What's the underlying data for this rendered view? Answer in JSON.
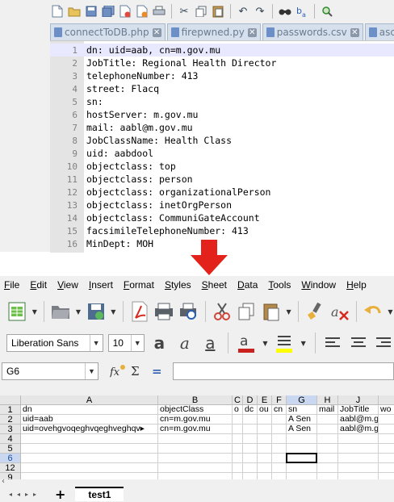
{
  "editor": {
    "toolbar_icons": [
      "new-file-icon",
      "open-file-icon",
      "save-icon",
      "save-all-icon",
      "close-icon",
      "close-all-icon",
      "print-icon",
      "cut-icon",
      "copy-icon",
      "paste-icon",
      "undo-icon",
      "redo-icon",
      "find-icon",
      "replace-icon",
      "zoom-icon"
    ],
    "tabs": [
      {
        "label": "connectToDB.php"
      },
      {
        "label": "firepwned.py"
      },
      {
        "label": "passwords.csv"
      },
      {
        "label": "ascii"
      }
    ],
    "lines": [
      {
        "num": "1",
        "text": "dn: uid=aab, cn=m.gov.mu"
      },
      {
        "num": "2",
        "text": "JobTitle: Regional Health Director"
      },
      {
        "num": "3",
        "text": "telephoneNumber: 413"
      },
      {
        "num": "4",
        "text": "street: Flacq"
      },
      {
        "num": "5",
        "text": "sn:"
      },
      {
        "num": "6",
        "text": "hostServer: m.gov.mu"
      },
      {
        "num": "7",
        "text": "mail: aabl@m.gov.mu"
      },
      {
        "num": "8",
        "text": "JobClassName: Health Class"
      },
      {
        "num": "9",
        "text": "uid: aabdool"
      },
      {
        "num": "10",
        "text": "objectclass: top"
      },
      {
        "num": "11",
        "text": "objectclass: person"
      },
      {
        "num": "12",
        "text": "objectclass: organizationalPerson"
      },
      {
        "num": "13",
        "text": "objectclass: inetOrgPerson"
      },
      {
        "num": "14",
        "text": "objectclass: CommuniGateAccount"
      },
      {
        "num": "15",
        "text": "facsimileTelephoneNumber: 413"
      },
      {
        "num": "16",
        "text": "MinDept: MOH"
      }
    ]
  },
  "calc": {
    "menu": [
      "File",
      "Edit",
      "View",
      "Insert",
      "Format",
      "Styles",
      "Sheet",
      "Data",
      "Tools",
      "Window",
      "Help"
    ],
    "font_name": "Liberation Sans",
    "font_size": "10",
    "name_box": "G6",
    "columns": [
      {
        "label": "A",
        "selected": false
      },
      {
        "label": "B",
        "selected": false
      },
      {
        "label": "C",
        "selected": false
      },
      {
        "label": "D",
        "selected": false
      },
      {
        "label": "E",
        "selected": false
      },
      {
        "label": "F",
        "selected": false
      },
      {
        "label": "G",
        "selected": true
      },
      {
        "label": "H",
        "selected": false
      },
      {
        "label": "J",
        "selected": false
      }
    ],
    "rows": [
      {
        "label": "1",
        "selected": false,
        "cells": [
          "dn",
          "objectClass",
          "o",
          "dc",
          "ou",
          "cn",
          "sn",
          "mail",
          "JobTitle",
          "wo"
        ]
      },
      {
        "label": "2",
        "selected": false,
        "cells": [
          "uid=aab",
          " cn=m.gov.mu",
          "",
          "",
          "",
          "",
          "A Sen",
          "",
          "aabl@m.g",
          ""
        ]
      },
      {
        "label": "3",
        "selected": false,
        "cells": [
          "uid=ovehgvoqeghvqeghveghqv▸",
          " cn=m.gov.mu",
          "",
          "",
          "",
          "",
          "A Sen",
          "",
          "aabl@m.g",
          ""
        ]
      },
      {
        "label": "4",
        "selected": false,
        "cells": [
          "",
          "",
          "",
          "",
          "",
          "",
          "",
          "",
          "",
          ""
        ]
      },
      {
        "label": "5",
        "selected": false,
        "cells": [
          "",
          "",
          "",
          "",
          "",
          "",
          "",
          "",
          "",
          ""
        ]
      },
      {
        "label": "6",
        "selected": true,
        "cells": [
          "",
          "",
          "",
          "",
          "",
          "",
          "",
          "",
          "",
          ""
        ]
      },
      {
        "label": "12",
        "selected": false,
        "cells": [
          "",
          "",
          "",
          "",
          "",
          "",
          "",
          "",
          "",
          ""
        ]
      },
      {
        "label": "9",
        "selected": false,
        "cells": [
          "",
          "",
          "",
          "",
          "",
          "",
          "",
          "",
          "",
          ""
        ]
      }
    ],
    "sheet_tab": "test1",
    "add_sheet_label": "+",
    "colors": {
      "accent_blue": "#1f4ea3",
      "arrow_red": "#e3231b",
      "selected_header": "#c9d7f0"
    }
  }
}
